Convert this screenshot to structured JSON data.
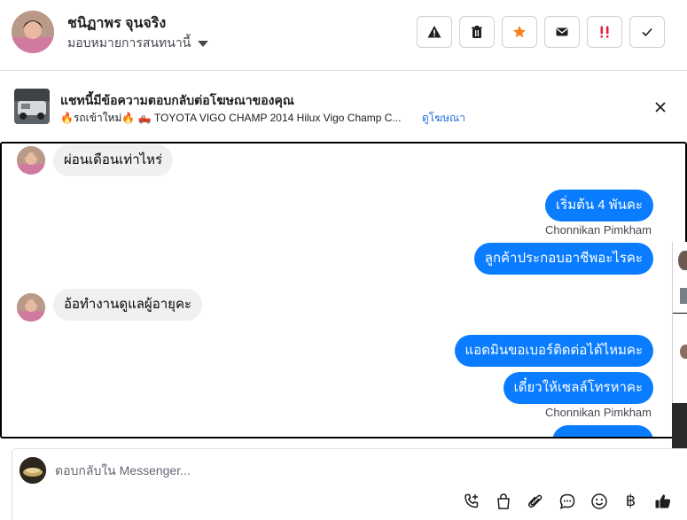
{
  "header": {
    "contact_name": "ชนิฏาพร จุนจริง",
    "assign_label": "มอบหมายการสนทนานี้"
  },
  "ad_banner": {
    "title": "แชทนี้มีข้อความตอบกลับต่อโฆษณาของคุณ",
    "ad_text": "🔥รถเข้าใหม่🔥 🛻 TOYOTA VIGO CHAMP 2014 Hilux Vigo Champ C...",
    "view_ad_label": "ดูโฆษณา"
  },
  "messages": [
    {
      "direction": "in",
      "text": "ผ่อนเดือนเท่าไหร่"
    },
    {
      "direction": "out",
      "text": "เริ่มต้น 4 พันคะ"
    },
    {
      "direction": "out",
      "text": "ลูกค้าประกอบอาชีพอะไรคะ",
      "sender": "Chonnikan Pimkham"
    },
    {
      "direction": "in",
      "text": "อ้อทำงานดูแลผู้อายุคะ"
    },
    {
      "direction": "out",
      "text": "แอดมินขอเบอร์ติดต่อได้ไหมคะ"
    },
    {
      "direction": "out",
      "text": "เดี๋ยวให้เซลล์โทรหาคะ",
      "sender": "Chonnikan Pimkham"
    }
  ],
  "composer": {
    "placeholder": "ตอบกลับใน Messenger...",
    "baht_symbol": "฿"
  },
  "colors": {
    "outgoing_bubble": "#0a7cff",
    "incoming_bubble": "#f0f0f0",
    "link": "#216fdb",
    "star": "#f5821f",
    "spam": "#e41e3f"
  },
  "icons": {
    "header_actions": [
      "warning-icon",
      "trash-icon",
      "star-icon",
      "envelope-icon",
      "spam-icon",
      "check-icon"
    ],
    "composer_tools": [
      "call-add-icon",
      "shopping-bag-icon",
      "paperclip-icon",
      "chat-bubble-icon",
      "emoji-icon",
      "baht-icon",
      "thumbs-up-icon"
    ]
  }
}
